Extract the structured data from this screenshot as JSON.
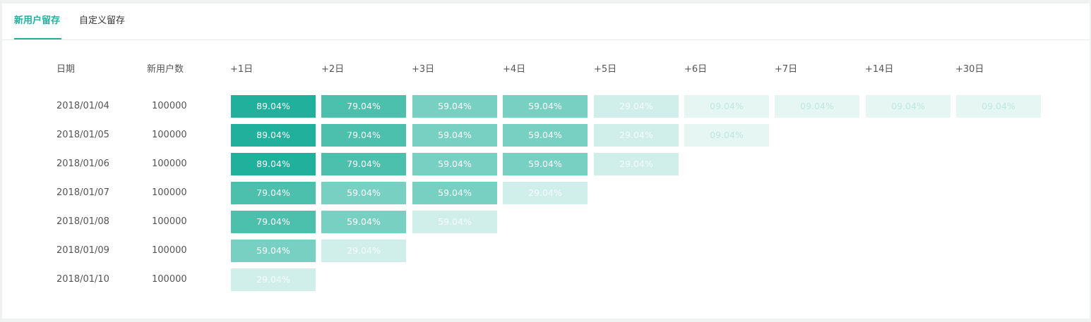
{
  "tabs": [
    {
      "label": "新用户留存",
      "active": true
    },
    {
      "label": "自定义留存",
      "active": false
    }
  ],
  "table": {
    "headers": [
      "日期",
      "新用户数",
      "+1日",
      "+2日",
      "+3日",
      "+4日",
      "+5日",
      "+6日",
      "+7日",
      "+14日",
      "+30日"
    ],
    "rows": [
      {
        "date": "2018/01/04",
        "users": "100000",
        "values": [
          "89.04%",
          "79.04%",
          "59.04%",
          "59.04%",
          "29.04%",
          "09.04%",
          "09.04%",
          "09.04%",
          "09.04%"
        ],
        "levels": [
          5,
          4,
          3,
          3,
          2,
          1,
          1,
          1,
          1
        ]
      },
      {
        "date": "2018/01/05",
        "users": "100000",
        "values": [
          "89.04%",
          "79.04%",
          "59.04%",
          "59.04%",
          "29.04%",
          "09.04%"
        ],
        "levels": [
          5,
          4,
          3,
          3,
          2,
          1
        ]
      },
      {
        "date": "2018/01/06",
        "users": "100000",
        "values": [
          "89.04%",
          "79.04%",
          "59.04%",
          "59.04%",
          "29.04%"
        ],
        "levels": [
          5,
          4,
          3,
          3,
          2
        ]
      },
      {
        "date": "2018/01/07",
        "users": "100000",
        "values": [
          "79.04%",
          "59.04%",
          "59.04%",
          "29.04%"
        ],
        "levels": [
          4,
          3,
          3,
          2
        ]
      },
      {
        "date": "2018/01/08",
        "users": "100000",
        "values": [
          "79.04%",
          "59.04%",
          "59.04%"
        ],
        "levels": [
          4,
          3,
          2
        ]
      },
      {
        "date": "2018/01/09",
        "users": "100000",
        "values": [
          "59.04%",
          "29.04%"
        ],
        "levels": [
          3,
          2
        ]
      },
      {
        "date": "2018/01/10",
        "users": "100000",
        "values": [
          "29.04%"
        ],
        "levels": [
          2
        ]
      }
    ]
  },
  "colors": {
    "accent": "#20b09c",
    "level_bg": {
      "1": "#e6f6f3",
      "2": "#d1efea",
      "3": "#78d0c2",
      "4": "#4cc0ad",
      "5": "#20b09c"
    },
    "level_fg": {
      "1": "#bfe8e1",
      "2": "#f4fbfa",
      "3": "#ffffff",
      "4": "#ffffff",
      "5": "#ffffff"
    }
  }
}
